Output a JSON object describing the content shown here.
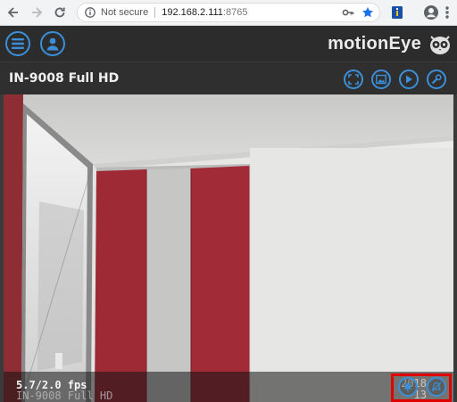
{
  "browser": {
    "security_label": "Not secure",
    "host": "192.168.2.111",
    "port": ":8765"
  },
  "app": {
    "brand": "motionEye"
  },
  "camera": {
    "name": "IN-9008 Full HD",
    "fps_label": "5.7/2.0 fps",
    "osd_name": "IN-9008 Full HD",
    "osd_date": "2018",
    "osd_time": "13"
  },
  "colors": {
    "accent": "#3b8fd8",
    "highlight": "#e00000",
    "wall": "#e9e9e7",
    "cabinet_red": "#9e2a35"
  },
  "icons": {
    "back": "arrow-left-icon",
    "forward": "arrow-right-icon",
    "reload": "reload-icon",
    "info": "info-icon",
    "key": "key-icon",
    "star": "star-icon",
    "extension": "extension-icon",
    "account": "account-icon",
    "menu": "kebab-menu-icon",
    "hamburger": "hamburger-icon",
    "user": "user-icon",
    "owl": "owl-logo",
    "fullscreen": "fullscreen-icon",
    "pictures": "picture-icon",
    "movies": "play-icon",
    "settings": "wrench-icon",
    "alarm": "bell-icon",
    "alarm_off": "bell-off-icon"
  }
}
